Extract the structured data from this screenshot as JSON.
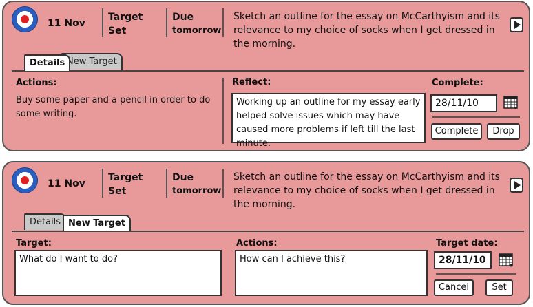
{
  "cards": [
    {
      "date": "11 Nov",
      "type_line1": "Target",
      "type_line2": "Set",
      "due_line1": "Due",
      "due_line2": "tomorrow",
      "description": "Sketch an outline for the essay on McCarthyism and its relevance to my choice of socks when I get dressed in the morning.",
      "tabs": {
        "details": "Details",
        "new_target": "New Target",
        "active": "details"
      },
      "actions_label": "Actions:",
      "actions_text": "Buy some paper and a pencil in order to do some writing.",
      "reflect_label": "Reflect:",
      "reflect_text": "Working up an outline for my essay early helped solve issues which may have caused more problems if left till the last minute.",
      "complete_label": "Complete:",
      "complete_date": "28/11/10",
      "complete_button": "Complete",
      "drop_button": "Drop"
    },
    {
      "date": "11 Nov",
      "type_line1": "Target",
      "type_line2": "Set",
      "due_line1": "Due",
      "due_line2": "tomorrow",
      "description": "Sketch an outline for the essay on McCarthyism and its relevance to my choice of socks when I get dressed in the morning.",
      "tabs": {
        "details": "Details",
        "new_target": "New Target",
        "active": "new_target"
      },
      "target_label": "Target:",
      "target_placeholder": "What do I want to do?",
      "actions_label": "Actions:",
      "actions_placeholder": "How can I achieve this?",
      "target_date_label": "Target date:",
      "target_date": "28/11/10",
      "cancel_button": "Cancel",
      "set_button": "Set"
    }
  ],
  "colors": {
    "card_bg": "#e89a9a",
    "border": "#555555",
    "tab_inactive": "#c9c9c9"
  },
  "icons": [
    "roundel-icon",
    "play-icon",
    "calendar-icon"
  ]
}
